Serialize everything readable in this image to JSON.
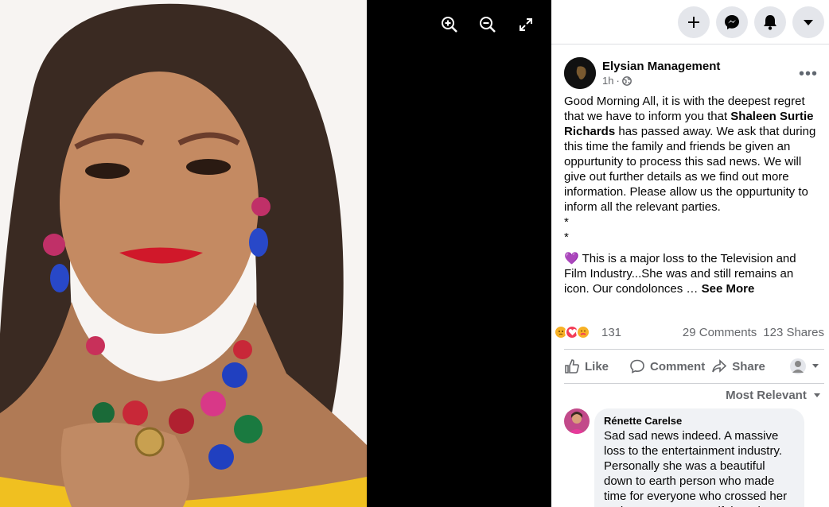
{
  "viewer": {
    "zoom_in_icon": "zoom-in-icon",
    "zoom_out_icon": "zoom-out-icon",
    "fullscreen_icon": "expand-icon"
  },
  "topbar": {
    "buttons": [
      "plus-icon",
      "messenger-icon",
      "bell-icon",
      "caret-down-icon"
    ]
  },
  "post": {
    "page_name": "Elysian Management",
    "time": "1h",
    "audience_icon": "globe-icon",
    "body_p1_a": "Good Morning All, it is with the deepest regret that we have to inform you that ",
    "body_p1_bold": "Shaleen Surtie Richards",
    "body_p1_b": " has passed away. We ask that during this time the family and friends be given an oppurtunity to process this sad news. We will give out further details as we find out more information. Please allow us the oppurtunity to inform all the relevant parties.",
    "star1": "*",
    "star2": "*",
    "heart_emoji": "💜",
    "body_p2": " This is a major loss to the Television and Film Industry...She was and still remains an icon. Our condolonces … ",
    "see_more": "See More",
    "reaction_count": "131",
    "comments_count": "29 Comments",
    "shares_count": "123 Shares",
    "like_label": "Like",
    "comment_label": "Comment",
    "share_label": "Share"
  },
  "comments": {
    "sort_label": "Most Relevant",
    "items": [
      {
        "name": "Rénette Carelse",
        "text": "Sad sad news indeed. A massive loss to the entertainment industry. Personally she was a beautiful down to earth person who made time for everyone who crossed her path. May Your Beautiful Soul Rest"
      }
    ]
  },
  "colors": {
    "accent_grey": "#65676b",
    "button_bg": "#e4e6eb",
    "bubble_bg": "#f0f2f5",
    "purple_heart": "#8a2be2"
  }
}
